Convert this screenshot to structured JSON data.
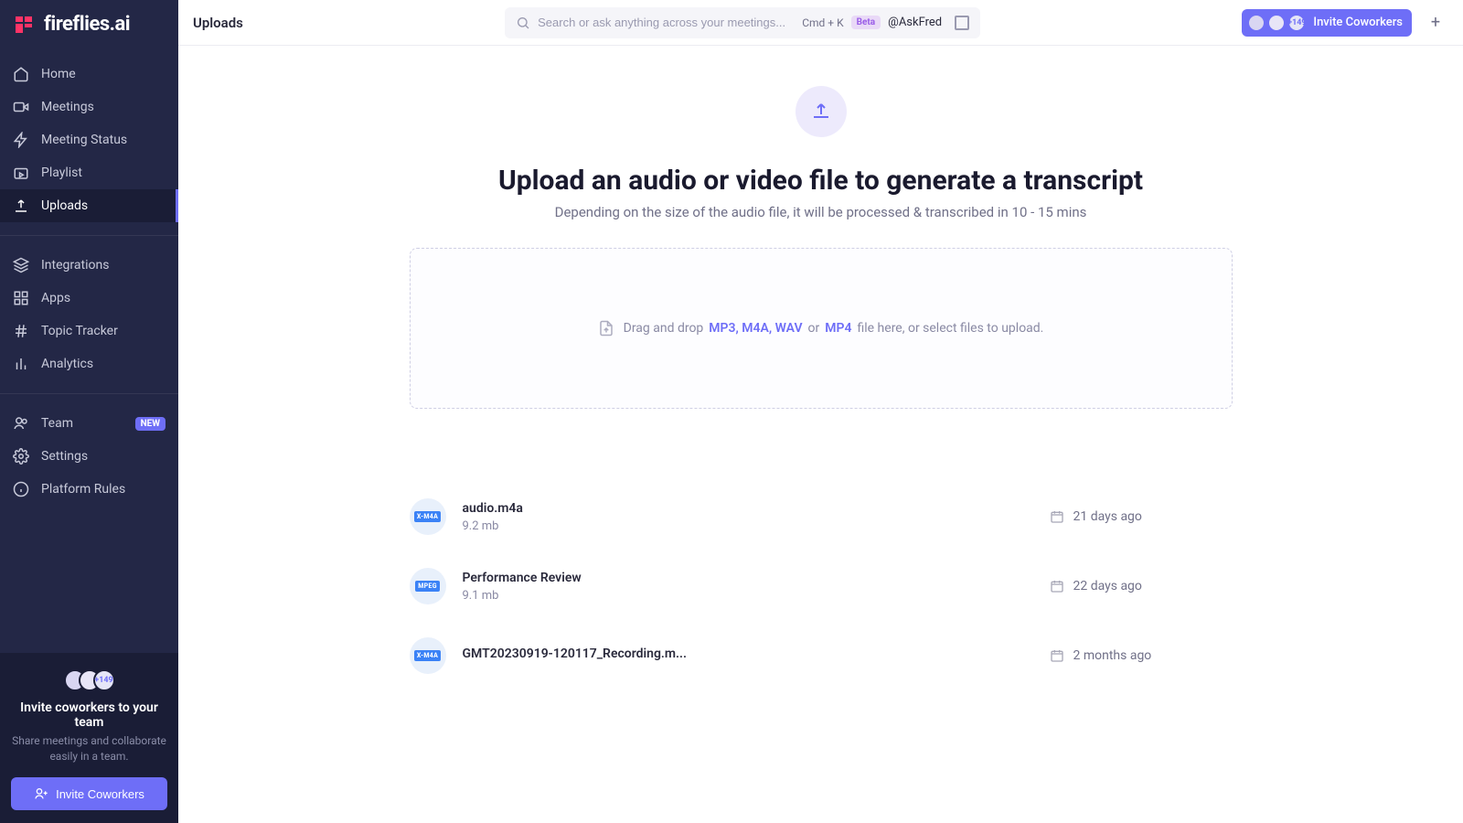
{
  "brand": {
    "name": "fireflies.ai"
  },
  "sidebar": {
    "items": [
      {
        "label": "Home"
      },
      {
        "label": "Meetings"
      },
      {
        "label": "Meeting Status"
      },
      {
        "label": "Playlist"
      },
      {
        "label": "Uploads"
      },
      {
        "label": "Integrations"
      },
      {
        "label": "Apps"
      },
      {
        "label": "Topic Tracker"
      },
      {
        "label": "Analytics"
      },
      {
        "label": "Team",
        "badge": "NEW"
      },
      {
        "label": "Settings"
      },
      {
        "label": "Platform Rules"
      }
    ],
    "invite": {
      "count_label": "+149",
      "title": "Invite coworkers to your team",
      "subtitle": "Share meetings and collaborate easily in a team.",
      "cta": "Invite Coworkers"
    }
  },
  "topbar": {
    "title": "Uploads",
    "search_placeholder": "Search or ask anything across your meetings...",
    "shortcut": "Cmd + K",
    "beta": "Beta",
    "askfred": "@AskFred",
    "invite_label": "Invite Coworkers",
    "invite_count": "+149"
  },
  "hero": {
    "title": "Upload an audio or video file to generate a transcript",
    "subtitle": "Depending on the size of the audio file, it will be processed & transcribed in 10 - 15 mins",
    "dropzone": {
      "pre": "Drag and drop",
      "formats1": "MP3, M4A, WAV",
      "or": "or",
      "formats2": "MP4",
      "post": "file here, or select files to upload."
    }
  },
  "files": [
    {
      "name": "audio.m4a",
      "size": "9.2 mb",
      "date": "21 days ago",
      "badge": "X-M4A"
    },
    {
      "name": "Performance Review",
      "size": "9.1 mb",
      "date": "22 days ago",
      "badge": "MPEG"
    },
    {
      "name": "GMT20230919-120117_Recording.m...",
      "size": "",
      "date": "2 months ago",
      "badge": "X-M4A"
    }
  ]
}
